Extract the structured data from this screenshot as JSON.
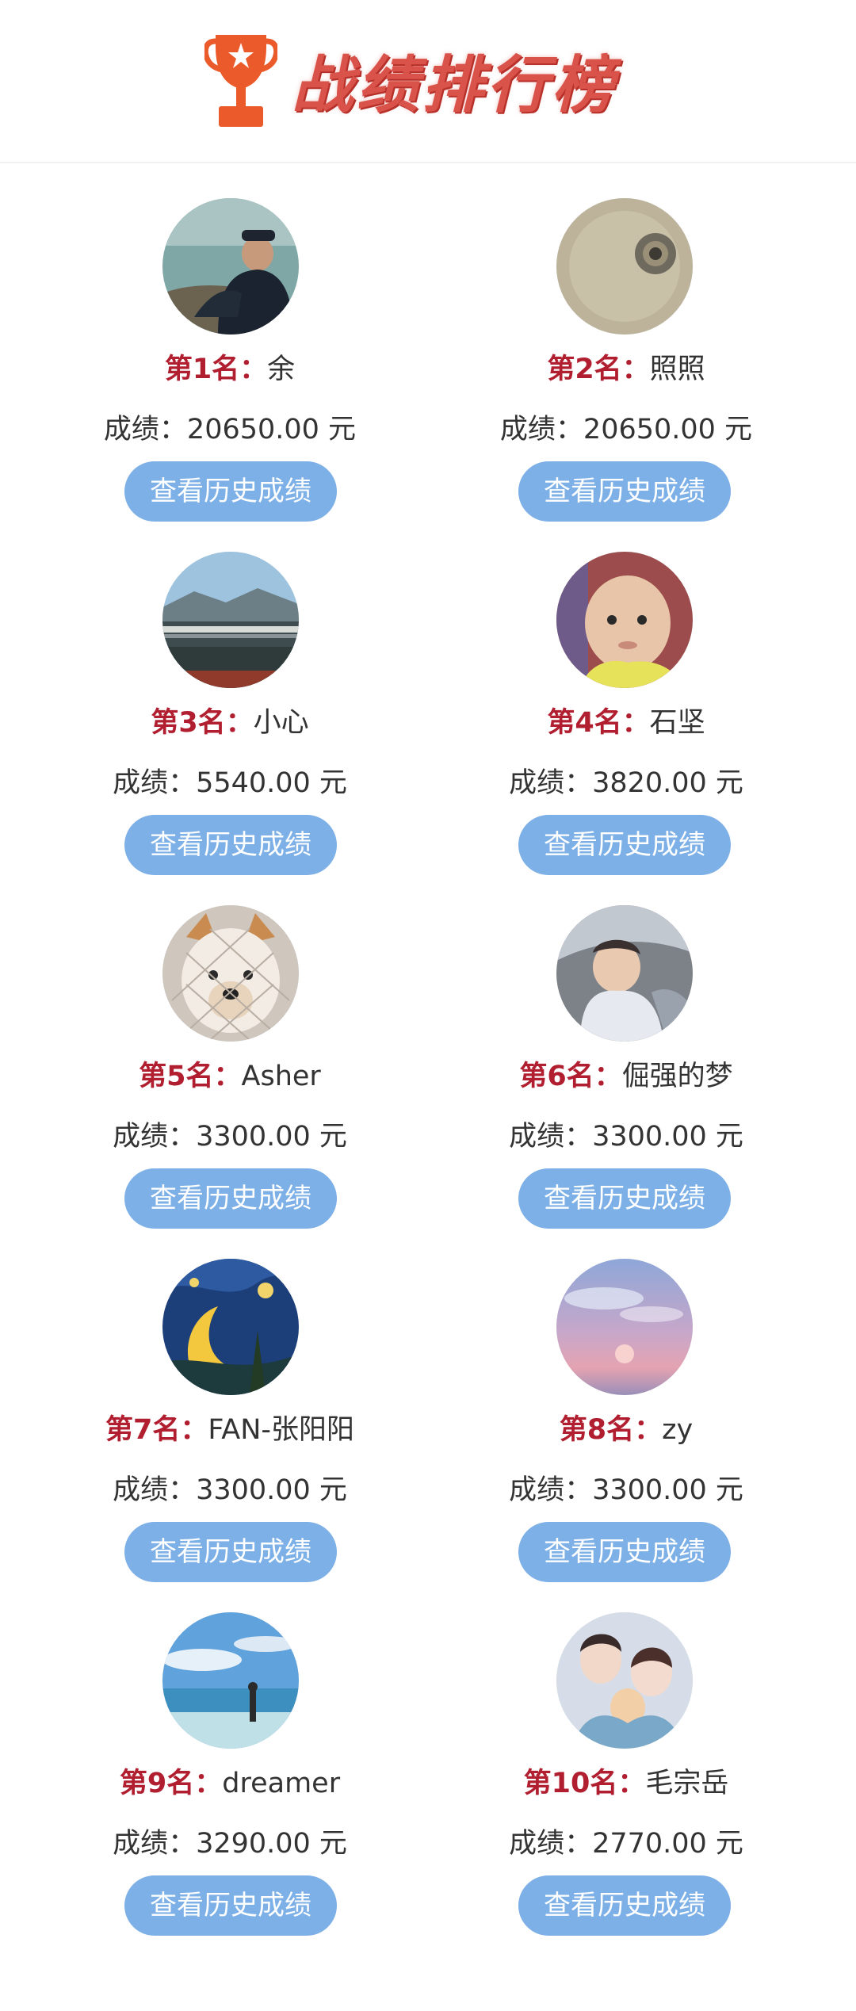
{
  "header": {
    "title": "战绩排行榜",
    "icon": "trophy-icon",
    "accent_color": "#e8542e"
  },
  "rank_prefix_color": "#b01e2f",
  "button_color": "#7db0e6",
  "rankings": [
    {
      "rank_label": "第1名：",
      "name": "余",
      "score": "成绩：20650.00 元",
      "button": "查看历史成绩",
      "avatar": "man-by-lake-avatar"
    },
    {
      "rank_label": "第2名：",
      "name": "照照",
      "score": "成绩：20650.00 元",
      "button": "查看历史成绩",
      "avatar": "pipe-tunnel-avatar"
    },
    {
      "rank_label": "第3名：",
      "name": "小心",
      "score": "成绩：5540.00 元",
      "button": "查看历史成绩",
      "avatar": "bridge-landscape-avatar"
    },
    {
      "rank_label": "第4名：",
      "name": "石坚",
      "score": "成绩：3820.00 元",
      "button": "查看历史成绩",
      "avatar": "baby-avatar"
    },
    {
      "rank_label": "第5名：",
      "name": "Asher",
      "score": "成绩：3300.00 元",
      "button": "查看历史成绩",
      "avatar": "dog-avatar"
    },
    {
      "rank_label": "第6名：",
      "name": "倔强的梦",
      "score": "成绩：3300.00 元",
      "button": "查看历史成绩",
      "avatar": "child-in-car-avatar"
    },
    {
      "rank_label": "第7名：",
      "name": "FAN-张阳阳",
      "score": "成绩：3300.00 元",
      "button": "查看历史成绩",
      "avatar": "starry-night-avatar"
    },
    {
      "rank_label": "第8名：",
      "name": "zy",
      "score": "成绩：3300.00 元",
      "button": "查看历史成绩",
      "avatar": "sunset-sky-avatar"
    },
    {
      "rank_label": "第9名：",
      "name": "dreamer",
      "score": "成绩：3290.00 元",
      "button": "查看历史成绩",
      "avatar": "beach-person-avatar"
    },
    {
      "rank_label": "第10名：",
      "name": "毛宗岳",
      "score": "成绩：2770.00 元",
      "button": "查看历史成绩",
      "avatar": "family-cartoon-avatar"
    }
  ]
}
